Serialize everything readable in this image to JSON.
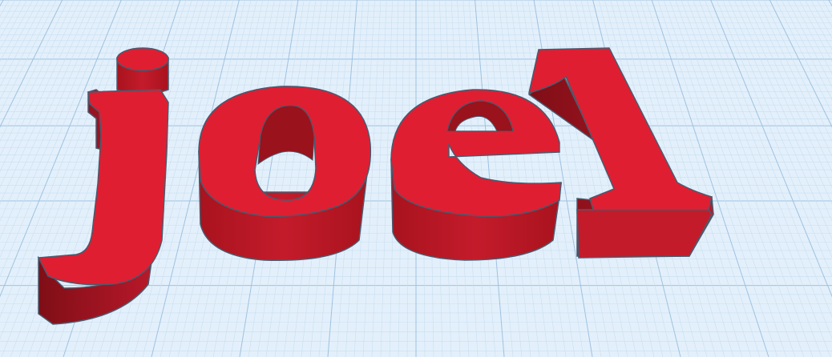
{
  "scene": {
    "name": "tinkercad-workplane",
    "model_text": "joel",
    "colors": {
      "background": "#e3f0fb",
      "grid_minor": "#c9def0",
      "grid_major": "#9fc2e0",
      "face": "#e01e32",
      "side_light": "#c81c2c",
      "side_mid": "#b0151f",
      "side_dark": "#8c1018",
      "edge": "#4a5a6e"
    }
  },
  "letters": [
    {
      "char": "j",
      "label": "letter-j"
    },
    {
      "char": "o",
      "label": "letter-o"
    },
    {
      "char": "e",
      "label": "letter-e"
    },
    {
      "char": "l",
      "label": "letter-l"
    }
  ]
}
